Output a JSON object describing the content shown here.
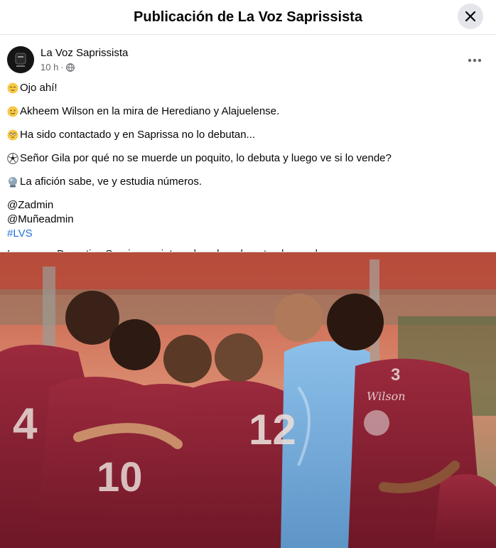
{
  "dialog": {
    "title": "Publicación de La Voz Saprissista",
    "close_icon": "close-icon"
  },
  "post": {
    "author": "La Voz Saprissista",
    "time": "10 h",
    "separator": "·",
    "audience_icon": "globe-icon",
    "more_icon": "more-horizontal-icon",
    "lines": [
      {
        "emoji": "relieved-face",
        "text": "Ojo ahí!"
      },
      {
        "emoji": "slightly-smiling-face",
        "text": "Akheem Wilson en la mira de Herediano y Alajuelense."
      },
      {
        "emoji": "eye-roll-face",
        "text": "Ha sido contactado y en Saprissa no lo debutan..."
      },
      {
        "emoji": "soccer-ball",
        "text": "Señor Gila por qué no se muerde un poquito, lo debuta y luego ve si lo vende?"
      },
      {
        "emoji": "crystal-ball",
        "text": "La afición sabe, ve y estudia números."
      }
    ],
    "mentions": [
      "@Zadmin",
      "@Muñeadmin"
    ],
    "hashtag": "#LVS",
    "disclaimer": "Imagenes Deportivo Saprissa sujeta a derechos de autor, los cuales, no poseeo.",
    "photo": {
      "jersey_numbers": [
        "4",
        "10",
        "12",
        "3"
      ],
      "jersey_sponsor": "Wilson"
    }
  },
  "colors": {
    "saprissa_maroon": "#8a1f33",
    "goalkeeper_blue": "#7fb3e0",
    "link_blue": "#216fdb",
    "meta_gray": "#65676b"
  }
}
